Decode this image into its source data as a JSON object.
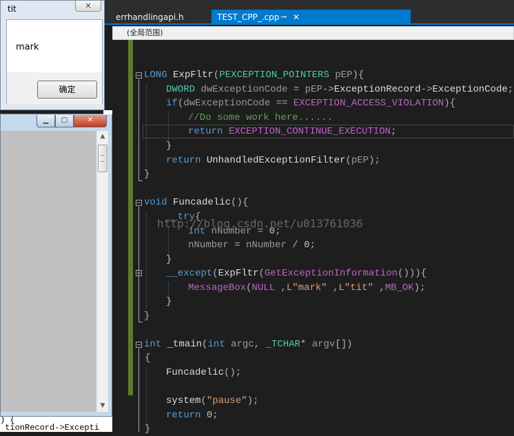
{
  "editor": {
    "tabs": [
      {
        "label": "errhandlingapi.h",
        "active": false
      },
      {
        "label": "TEST_CPP_.cpp",
        "active": true,
        "pin_icon": "pin-icon",
        "close_icon": "close-icon"
      }
    ],
    "scope": "(全局范围)",
    "watermark": "http://blog.csdn.net/u013761036",
    "code_lines": [
      [
        [
          "kw",
          "LONG"
        ],
        [
          "fn",
          " ExpFltr"
        ],
        [
          "pu",
          "("
        ],
        [
          "ty",
          "PEXCEPTION_POINTERS"
        ],
        [
          "pr",
          " pEP"
        ],
        [
          "pu",
          ")"
        ],
        [
          "pu",
          "{"
        ]
      ],
      [
        [
          "ty",
          "DWORD"
        ],
        [
          "pr",
          " dwExceptionCode"
        ],
        [
          "pu",
          " = "
        ],
        [
          "pr",
          "pEP"
        ],
        [
          "pu",
          "->"
        ],
        [
          "fn",
          "ExceptionRecord"
        ],
        [
          "pu",
          "->"
        ],
        [
          "fn",
          "ExceptionCode"
        ],
        [
          "pu",
          ";"
        ]
      ],
      [
        [
          "kw",
          "if"
        ],
        [
          "pu",
          "("
        ],
        [
          "pr",
          "dwExceptionCode"
        ],
        [
          "pu",
          " == "
        ],
        [
          "mc",
          "EXCEPTION_ACCESS_VIOLATION"
        ],
        [
          "pu",
          "){"
        ]
      ],
      [
        [
          "cm",
          "//Do some work here......"
        ]
      ],
      [
        [
          "kw",
          "return"
        ],
        [
          "mc",
          " EXCEPTION_CONTINUE_EXECUTION"
        ],
        [
          "pu",
          ";"
        ]
      ],
      [
        [
          "pu",
          "}"
        ]
      ],
      [
        [
          "kw",
          "return"
        ],
        [
          "fn",
          " UnhandledExceptionFilter"
        ],
        [
          "pu",
          "("
        ],
        [
          "pr",
          "pEP"
        ],
        [
          "pu",
          ");"
        ]
      ],
      [
        [
          "pu",
          "}"
        ]
      ],
      [],
      [
        [
          "kw",
          "void"
        ],
        [
          "fn",
          " Funcadelic"
        ],
        [
          "pu",
          "(){"
        ]
      ],
      [
        [
          "kw",
          "__try"
        ],
        [
          "pu",
          "{"
        ]
      ],
      [
        [
          "kw",
          "int"
        ],
        [
          "pr",
          " nNumber"
        ],
        [
          "pu",
          " = "
        ],
        [
          "nm",
          "0"
        ],
        [
          "pu",
          ";"
        ]
      ],
      [
        [
          "pr",
          "nNumber"
        ],
        [
          "pu",
          " = "
        ],
        [
          "pr",
          "nNumber"
        ],
        [
          "pu",
          " / "
        ],
        [
          "nm",
          "0"
        ],
        [
          "pu",
          ";"
        ]
      ],
      [
        [
          "pu",
          "}"
        ]
      ],
      [
        [
          "kw",
          "__except"
        ],
        [
          "pu",
          "("
        ],
        [
          "fn",
          "ExpFltr"
        ],
        [
          "pu",
          "("
        ],
        [
          "mc",
          "GetExceptionInformation"
        ],
        [
          "pu",
          "())){"
        ]
      ],
      [
        [
          "mc",
          "MessageBox"
        ],
        [
          "pu",
          "("
        ],
        [
          "mc",
          "NULL"
        ],
        [
          "pu",
          " ,"
        ],
        [
          "st",
          "L\"mark\""
        ],
        [
          "pu",
          " ,"
        ],
        [
          "st",
          "L\"tit\""
        ],
        [
          "pu",
          " ,"
        ],
        [
          "mc",
          "MB_OK"
        ],
        [
          "pu",
          ");"
        ]
      ],
      [
        [
          "pu",
          "}"
        ]
      ],
      [
        [
          "pu",
          "}"
        ]
      ],
      [],
      [
        [
          "kw",
          "int"
        ],
        [
          "fn",
          " _tmain"
        ],
        [
          "pu",
          "("
        ],
        [
          "kw",
          "int"
        ],
        [
          "pr",
          " argc"
        ],
        [
          "pu",
          ", "
        ],
        [
          "ty",
          "_TCHAR"
        ],
        [
          "pu",
          "* "
        ],
        [
          "pr",
          "argv"
        ],
        [
          "pu",
          "[])"
        ]
      ],
      [
        [
          "pu",
          "{"
        ]
      ],
      [
        [
          "fn",
          "Funcadelic"
        ],
        [
          "pu",
          "();"
        ]
      ],
      [],
      [
        [
          "fn",
          "system"
        ],
        [
          "pu",
          "("
        ],
        [
          "st",
          "\"pause\""
        ],
        [
          "pu",
          ");"
        ]
      ],
      [
        [
          "kw",
          "return"
        ],
        [
          "nm",
          " 0"
        ],
        [
          "pu",
          ";"
        ]
      ],
      [
        [
          "pu",
          "}"
        ]
      ]
    ]
  },
  "msgbox": {
    "title": "tit",
    "message": "mark",
    "ok_label": "确定",
    "close_label": "✕"
  },
  "console": {
    "min_label": "▁",
    "max_label": "□",
    "close_label": "✕"
  },
  "background_text": ") {\n tionRecord->Excepti"
}
